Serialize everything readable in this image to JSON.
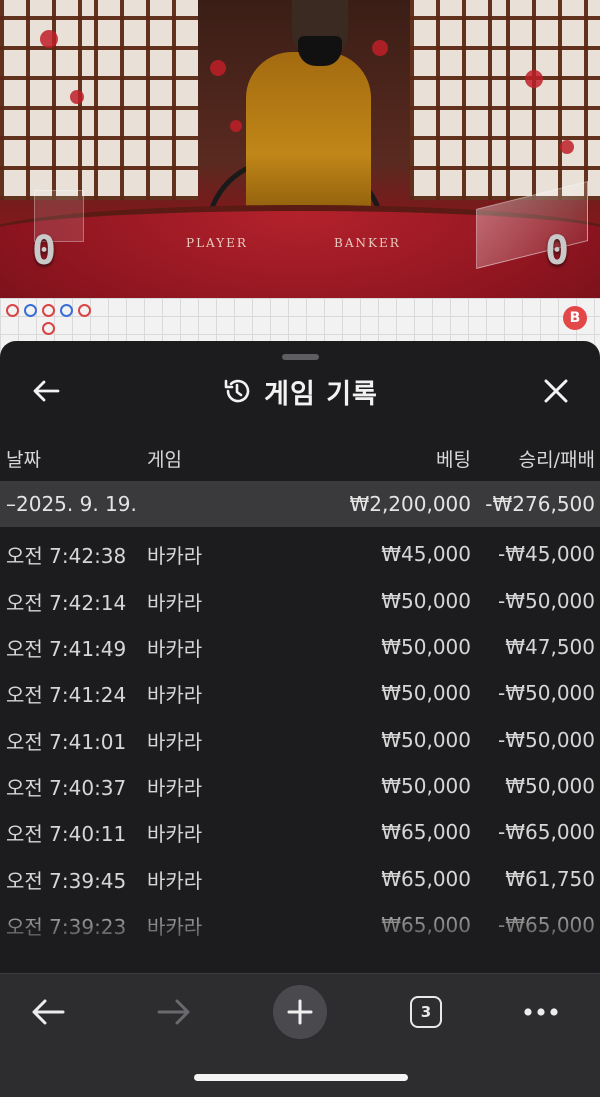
{
  "video": {
    "player_label": "PLAYER",
    "banker_label": "BANKER",
    "player_score": "0",
    "banker_score": "0"
  },
  "roadmap": {
    "b_marker": "B"
  },
  "sheet": {
    "title": "게임 기록",
    "columns": {
      "date": "날짜",
      "game": "게임",
      "bet": "베팅",
      "result": "승리/패배"
    },
    "summary": {
      "date": "–2025. 9. 19.",
      "bet": "₩2,200,000",
      "result": "-₩276,500"
    },
    "rows": [
      {
        "time": "오전 7:42:38",
        "game": "바카라",
        "bet": "₩45,000",
        "result": "-₩45,000"
      },
      {
        "time": "오전 7:42:14",
        "game": "바카라",
        "bet": "₩50,000",
        "result": "-₩50,000"
      },
      {
        "time": "오전 7:41:49",
        "game": "바카라",
        "bet": "₩50,000",
        "result": "₩47,500"
      },
      {
        "time": "오전 7:41:24",
        "game": "바카라",
        "bet": "₩50,000",
        "result": "-₩50,000"
      },
      {
        "time": "오전 7:41:01",
        "game": "바카라",
        "bet": "₩50,000",
        "result": "-₩50,000"
      },
      {
        "time": "오전 7:40:37",
        "game": "바카라",
        "bet": "₩50,000",
        "result": "₩50,000"
      },
      {
        "time": "오전 7:40:11",
        "game": "바카라",
        "bet": "₩65,000",
        "result": "-₩65,000"
      },
      {
        "time": "오전 7:39:45",
        "game": "바카라",
        "bet": "₩65,000",
        "result": "₩61,750"
      },
      {
        "time": "오전 7:39:23",
        "game": "바카라",
        "bet": "₩65,000",
        "result": "-₩65,000"
      }
    ]
  },
  "browser": {
    "tab_count": "3"
  }
}
